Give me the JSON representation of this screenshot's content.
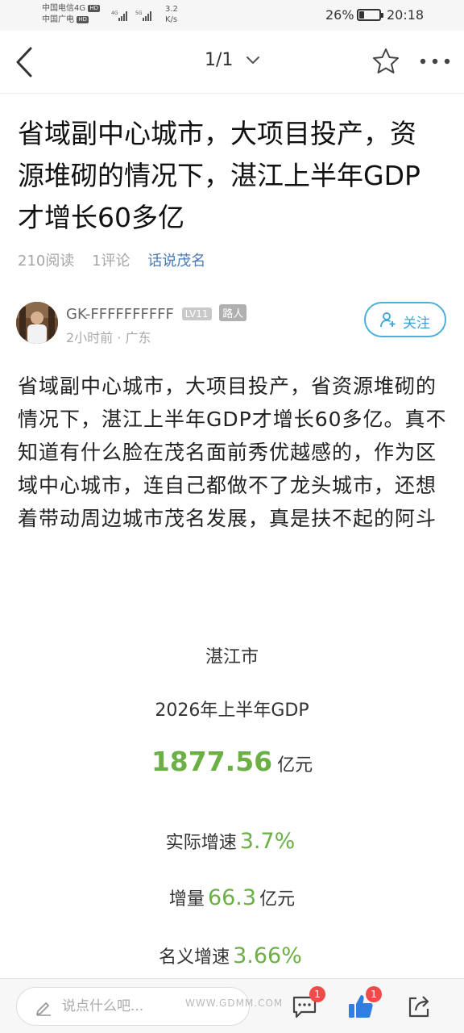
{
  "status_bar": {
    "carrier_line1": "中国电信4G",
    "carrier_line2": "中国广电",
    "hd_badge": "HD",
    "net_speed_value": "3.2",
    "net_speed_unit": "K/s",
    "battery_percent": "26%",
    "battery_level": 0.26,
    "time": "20:18"
  },
  "nav": {
    "page_indicator": "1/1",
    "back_icon": "back-arrow-icon",
    "star_icon": "star-icon",
    "more_icon": "more-dots-icon"
  },
  "post": {
    "title": "省域副中心城市，大项目投产，资源堆砌的情况下，湛江上半年GDP才增长60多亿",
    "read_count": "210阅读",
    "comment_count": "1评论",
    "topic": "话说茂名",
    "author": {
      "name": "GK-FFFFFFFFFF",
      "level": "LV11",
      "rank": "路人",
      "time": "2小时前",
      "location": "广东",
      "follow_label": "关注"
    },
    "body": "省域副中心城市，大项目投产，省资源堆砌的情况下，湛江上半年GDP才增长60多亿。真不知道有什么脸在茂名面前秀优越感的，作为区域中心城市，连自己都做不了龙头城市，还想着带动周边城市茂名发展，真是扶不起的阿斗"
  },
  "card": {
    "city": "湛江市",
    "period": "2026年上半年GDP",
    "gdp_value": "1877.56",
    "gdp_unit": "亿元",
    "real_growth_label": "实际增速",
    "real_growth_value": "3.7%",
    "increment_label": "增量",
    "increment_value": "66.3",
    "increment_unit": "亿元",
    "nominal_growth_label": "名义增速",
    "nominal_growth_value": "3.66%",
    "accent_color": "#6bb044"
  },
  "bottom_bar": {
    "comment_placeholder": "说点什么吧...",
    "comment_badge": "1",
    "like_badge": "1"
  },
  "watermark": "WWW.GDMM.COM"
}
